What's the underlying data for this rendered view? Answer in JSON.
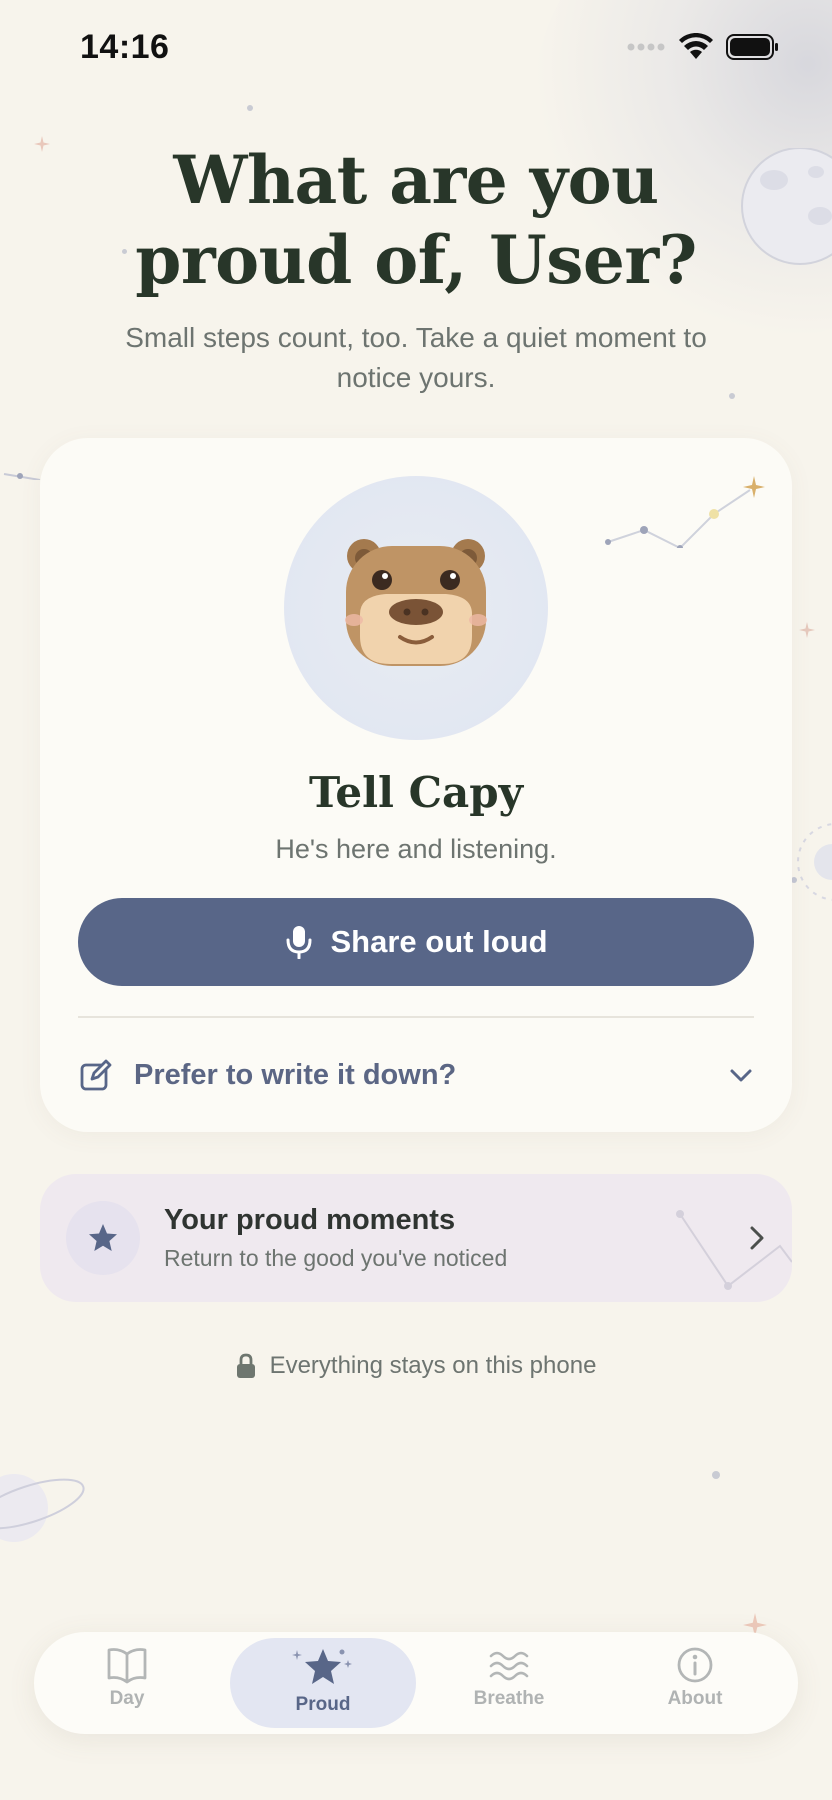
{
  "status": {
    "time": "14:16"
  },
  "header": {
    "title": "What are you proud of, User?",
    "subtitle": "Small steps count, too. Take a quiet moment to notice yours."
  },
  "card": {
    "avatar_icon": "capybara-face",
    "title": "Tell Capy",
    "subtitle": "He's here and listening.",
    "share_button": "Share out loud",
    "write_toggle": "Prefer to write it down?"
  },
  "moments": {
    "title": "Your proud moments",
    "subtitle": "Return to the good you've noticed"
  },
  "privacy_note": "Everything stays on this phone",
  "tabs": [
    {
      "label": "Day",
      "icon": "book-icon",
      "active": false
    },
    {
      "label": "Proud",
      "icon": "star-icon",
      "active": true
    },
    {
      "label": "Breathe",
      "icon": "waves-icon",
      "active": false
    },
    {
      "label": "About",
      "icon": "info-icon",
      "active": false
    }
  ],
  "colors": {
    "background": "#f7f4ec",
    "accent": "#586688",
    "title": "#283629",
    "muted": "#6d7470",
    "moments_bg": "#efe9ef"
  }
}
